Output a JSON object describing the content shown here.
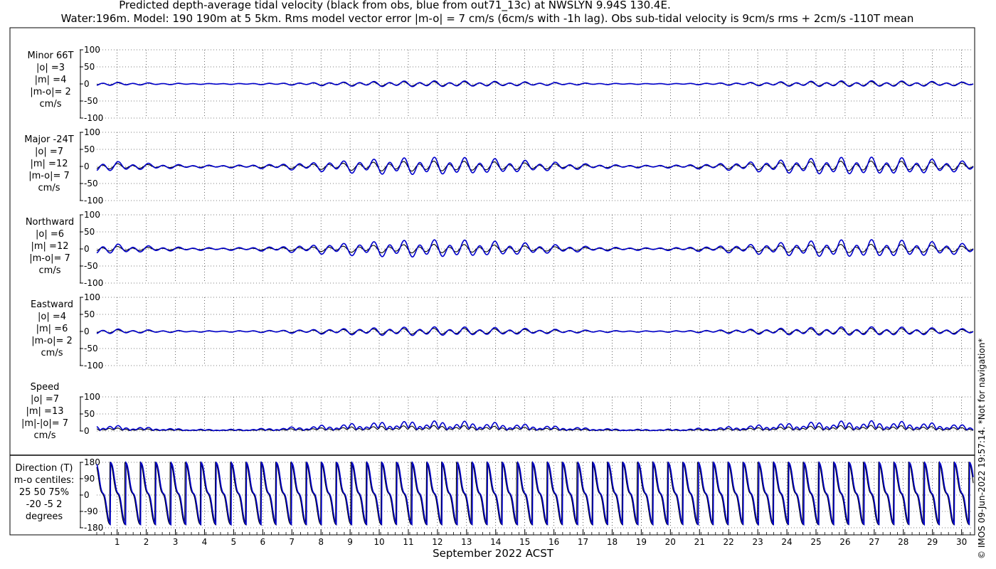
{
  "title_line1": "Predicted depth-average tidal velocity (black from obs, blue from out71_13c) at NWSLYN 9.94S 130.4E.",
  "title_line2": "Water:196m. Model: 190 190m at 5 5km. Rms model vector error |m-o| = 7 cm/s (6cm/s with -1h lag). Obs sub-tidal velocity is 9cm/s rms + 2cm/s -110T mean",
  "copyright": "© IMOS 09-Jun-2022 19:57:14. *Not for navigation*",
  "colors": {
    "obs": "#000000",
    "model": "#0000cc",
    "grid": "#000000"
  },
  "chart_data": {
    "type": "line",
    "xlabel": "September 2022 ACST",
    "x_ticks": [
      "1",
      "2",
      "3",
      "4",
      "5",
      "6",
      "7",
      "8",
      "9",
      "10",
      "11",
      "12",
      "13",
      "14",
      "15",
      "16",
      "17",
      "18",
      "19",
      "20",
      "21",
      "22",
      "23",
      "24",
      "25",
      "26",
      "27",
      "28",
      "29",
      "30"
    ],
    "xlim": [
      0.3,
      30.4
    ],
    "grid": true,
    "series_legend": {
      "obs": "black from obs",
      "model": "blue from out71_13c"
    },
    "panels": [
      {
        "label": [
          "Minor 66T",
          "|o| =3",
          "|m| =4",
          "|m-o|= 2",
          "cm/s"
        ],
        "ylim": [
          -100,
          100
        ],
        "y_ticks": [
          "100",
          "50",
          "0",
          "-50",
          "-100"
        ],
        "kind": "velocity",
        "amplitude": {
          "obs": 3,
          "model": 4
        }
      },
      {
        "label": [
          "Major -24T",
          "|o| =7",
          "|m| =12",
          "|m-o|= 7",
          "cm/s"
        ],
        "ylim": [
          -100,
          100
        ],
        "y_ticks": [
          "100",
          "50",
          "0",
          "-50",
          "-100"
        ],
        "kind": "velocity",
        "amplitude": {
          "obs": 7,
          "model": 12
        }
      },
      {
        "label": [
          "Northward",
          "|o| =6",
          "|m| =12",
          "|m-o|= 7",
          "cm/s"
        ],
        "ylim": [
          -100,
          100
        ],
        "y_ticks": [
          "100",
          "50",
          "0",
          "-50",
          "-100"
        ],
        "kind": "velocity",
        "amplitude": {
          "obs": 6,
          "model": 12
        }
      },
      {
        "label": [
          "Eastward",
          "|o| =4",
          "|m| =6",
          "|m-o|= 2",
          "cm/s"
        ],
        "ylim": [
          -100,
          100
        ],
        "y_ticks": [
          "100",
          "50",
          "0",
          "-50",
          "-100"
        ],
        "kind": "velocity",
        "amplitude": {
          "obs": 4,
          "model": 6
        }
      },
      {
        "label": [
          "Speed",
          "|o| =7",
          "|m| =13",
          "|m|-|o|= 7",
          "cm/s"
        ],
        "ylim": [
          0,
          100
        ],
        "y_ticks": [
          "100",
          "50",
          "0"
        ],
        "kind": "speed",
        "amplitude": {
          "obs": 7,
          "model": 13
        }
      },
      {
        "label": [
          "Direction (T)",
          "m-o centiles:",
          "25  50  75%",
          "-20  -5   2",
          "degrees"
        ],
        "ylim": [
          -180,
          180
        ],
        "y_ticks": [
          "180",
          "90",
          "0",
          "-90",
          "-180"
        ],
        "kind": "direction"
      }
    ]
  }
}
